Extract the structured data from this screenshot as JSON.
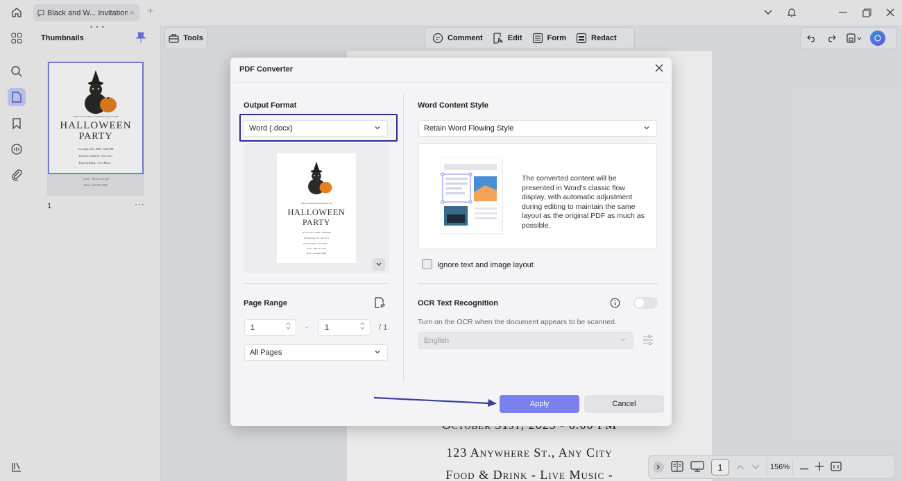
{
  "tab": {
    "title": "Black and W... Invitation"
  },
  "thumbnails": {
    "title": "Thumbnails",
    "page_number": "1",
    "more": "···"
  },
  "toolbar": {
    "tools_label": "Tools",
    "comment_label": "Comment",
    "edit_label": "Edit",
    "form_label": "Form",
    "redact_label": "Redact"
  },
  "document": {
    "line1": "October 31st, 2025 - 6:00 PM",
    "line2": "123 Anywhere St., Any City",
    "line3": "Food & Drink - Live Music -"
  },
  "invitation": {
    "small_header": "JOIN US FOR A SPOOKTACULAR",
    "title_line1": "HALLOWEEN",
    "title_line2": "PARTY",
    "date": "October 31st, 2025 - 6:00 PM",
    "address": "123 Anywhere St., Any City",
    "extras": "Food & Drink - Live Music -",
    "extras2": "Games - Best Costume",
    "rsvp": "Reply 123-456-7890"
  },
  "dialog": {
    "title": "PDF Converter",
    "output_format": {
      "label": "Output Format",
      "value": "Word (.docx)"
    },
    "page_range": {
      "label": "Page Range",
      "from": "1",
      "dash": "-",
      "to": "1",
      "total": "/ 1",
      "scope": "All Pages"
    },
    "word_content_style": {
      "label": "Word Content Style",
      "value": "Retain Word Flowing Style",
      "description": "The converted content will be presented in Word's classic flow display, with automatic adjustment during editing to maintain the same layout as the original PDF as much as possible."
    },
    "ignore_layout": {
      "label": "Ignore text and image layout",
      "checked": false
    },
    "ocr": {
      "label": "OCR Text Recognition",
      "enabled": false,
      "hint": "Turn on the OCR when the document appears to be scanned.",
      "language": "English"
    },
    "apply_label": "Apply",
    "cancel_label": "Cancel"
  },
  "statusbar": {
    "page": "1",
    "zoom": "156%"
  },
  "colors": {
    "accent": "#7b80f0",
    "focus": "#2b2f8c",
    "arrow": "#3a3fa0"
  }
}
